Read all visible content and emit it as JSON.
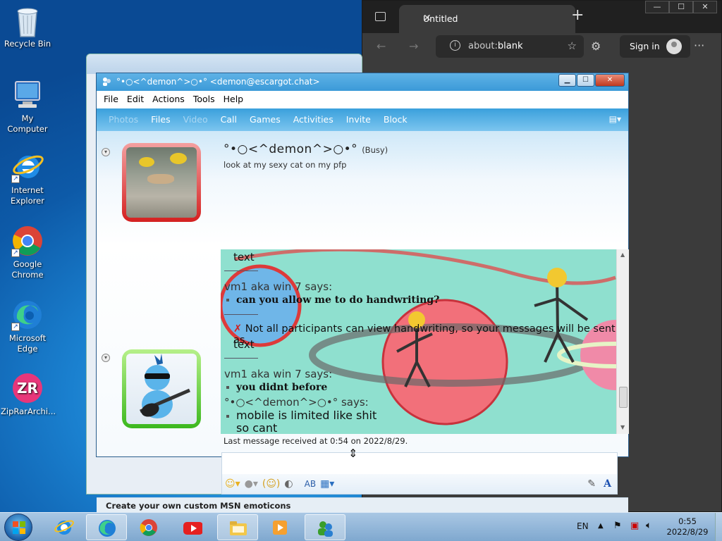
{
  "desktop": {
    "icons": [
      {
        "label": "Recycle Bin"
      },
      {
        "label": "My Computer"
      },
      {
        "label": "Internet Explorer"
      },
      {
        "label": "Google Chrome"
      },
      {
        "label": "Microsoft Edge"
      },
      {
        "label": "ZipRarArchi..."
      }
    ]
  },
  "edge": {
    "tab_title": "Untitled",
    "tab_close": "✕",
    "new_tab": "+",
    "address_prefix": "about:",
    "address_host": "blank",
    "sign_in": "Sign in",
    "more": "···",
    "min": "—",
    "max": "☐",
    "close": "✕"
  },
  "msn": {
    "title": "°•○<^demon^>○•° <demon@escargot.chat>",
    "menu": [
      "File",
      "Edit",
      "Actions",
      "Tools",
      "Help"
    ],
    "actions": [
      {
        "label": "Photos",
        "enabled": false
      },
      {
        "label": "Files",
        "enabled": true
      },
      {
        "label": "Video",
        "enabled": false
      },
      {
        "label": "Call",
        "enabled": true
      },
      {
        "label": "Games",
        "enabled": true
      },
      {
        "label": "Activities",
        "enabled": true
      },
      {
        "label": "Invite",
        "enabled": true
      },
      {
        "label": "Block",
        "enabled": true
      }
    ],
    "contact": {
      "name": "°•○<^demon^>○•°",
      "status": "(Busy)",
      "message": "look at my sexy cat on my pfp"
    },
    "chat": {
      "lines": [
        {
          "type": "text",
          "text": "text"
        },
        {
          "type": "sender",
          "text": "vm1 aka win 7 says:"
        },
        {
          "type": "bold",
          "text": "can you allow me to do handwriting?"
        },
        {
          "type": "warning",
          "text": "Not all participants can view handwriting, so your messages will be sent as"
        },
        {
          "type": "text",
          "text": "text"
        },
        {
          "type": "sender",
          "text": "vm1 aka win 7 says:"
        },
        {
          "type": "bold",
          "text": "you didnt before"
        },
        {
          "type": "sender",
          "text": "°•○<^demon^>○•° says:"
        },
        {
          "type": "plain",
          "text": "mobile is limited like shit"
        },
        {
          "type": "plain",
          "text": "so cant"
        }
      ]
    },
    "last_message": "Last message received at 0:54 on 2022/8/29.",
    "bottom_link": "Create your own custom MSN emoticons"
  },
  "taskbar": {
    "lang": "EN",
    "time": "0:55",
    "date": "2022/8/29"
  }
}
